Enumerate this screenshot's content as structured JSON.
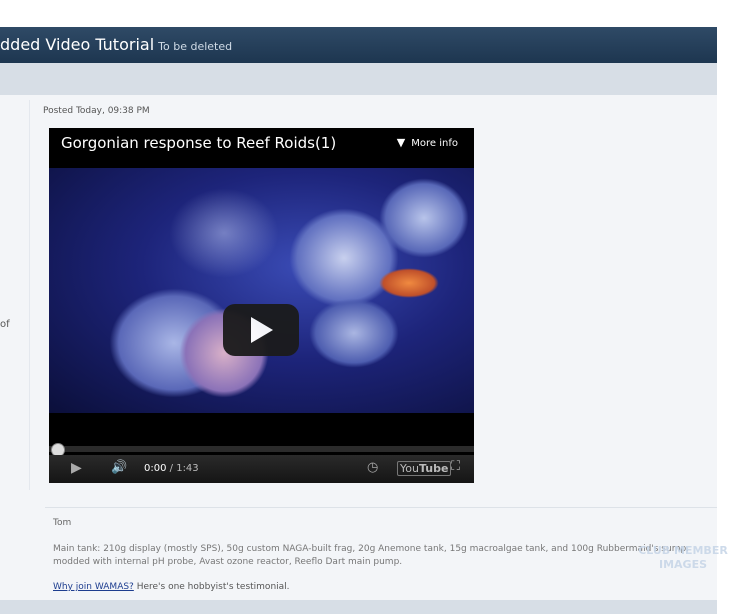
{
  "header": {
    "title": "dded Video Tutorial",
    "subtitle": "To be deleted"
  },
  "leftcol": {
    "fragment": "of"
  },
  "post": {
    "posted": "Posted Today, 09:38 PM",
    "video": {
      "title": "Gorgonian response to Reef Roids(1)",
      "more_info": "More info",
      "current_time": "0:00",
      "separator": " / ",
      "duration": "1:43",
      "progress_fraction": 0
    },
    "signature": {
      "name": "Tom",
      "text": "Main tank: 210g display (mostly SPS), 50g custom NAGA-built frag, 20g Anemone tank, 15g macroalgae tank, and 100g Rubbermaid's sump. modded with internal pH probe, Avast ozone reactor, Reeflo Dart main pump.",
      "why_link": "Why join WAMAS?",
      "why_rest": " Here's one hobbyist's testimonial."
    }
  },
  "watermark": {
    "line1": "CLUB MEMBER",
    "line2": "IMAGES"
  },
  "icons": [
    "chevron-down-icon",
    "play-icon",
    "volume-icon",
    "clock-icon",
    "youtube-logo",
    "fullscreen-icon"
  ]
}
